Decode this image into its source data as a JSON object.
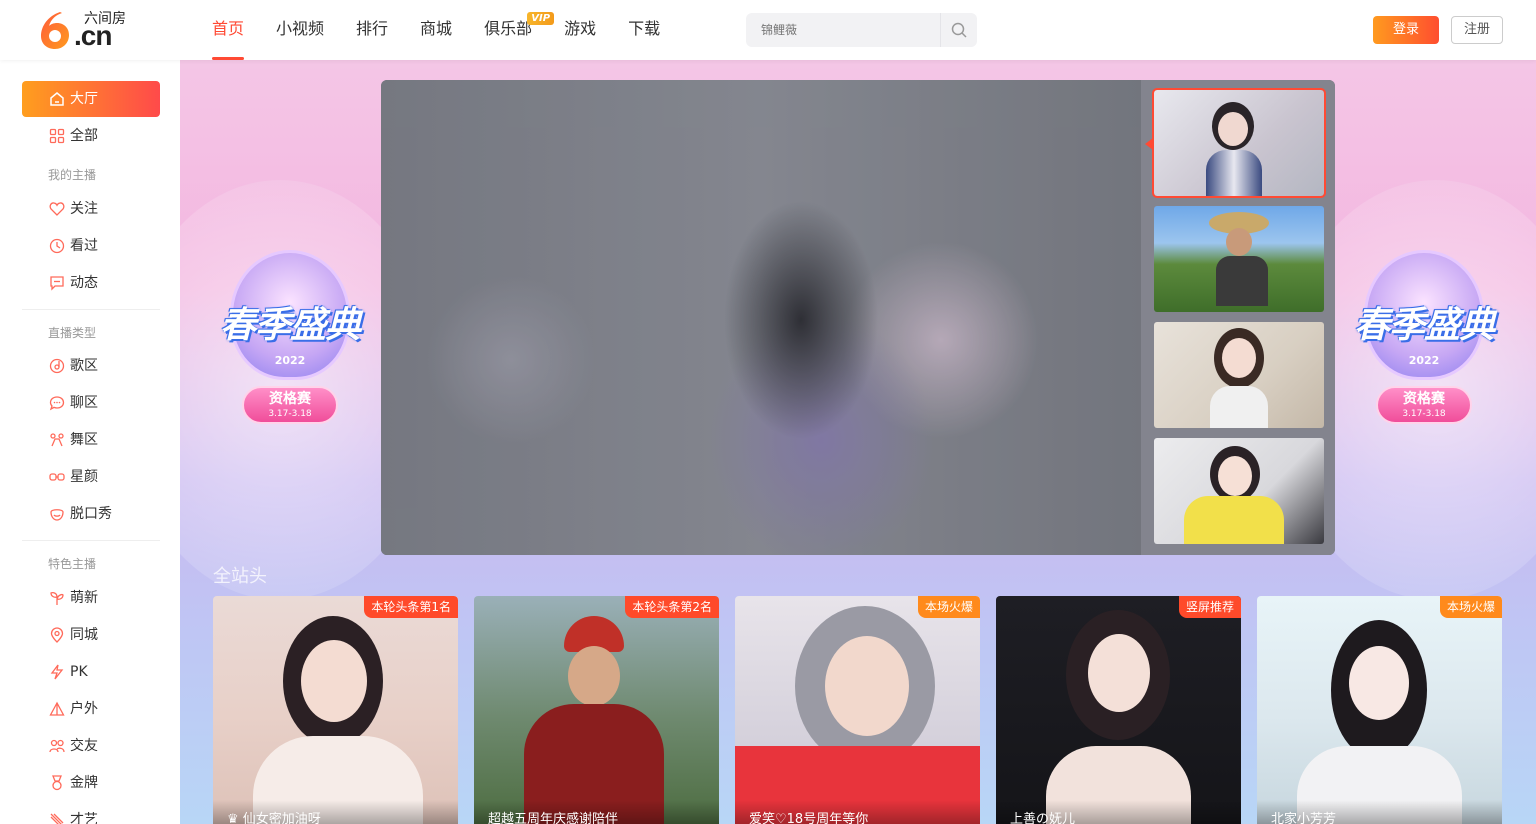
{
  "header": {
    "logo_text": "六间房",
    "logo_cn": ".cn",
    "nav": [
      {
        "label": "首页",
        "active": true
      },
      {
        "label": "小视频"
      },
      {
        "label": "排行"
      },
      {
        "label": "商城"
      },
      {
        "label": "俱乐部",
        "badge": "VIP"
      },
      {
        "label": "游戏"
      },
      {
        "label": "下载"
      }
    ],
    "search": {
      "placeholder": "锦鲤薇"
    },
    "login_label": "登录",
    "register_label": "注册"
  },
  "sidebar": {
    "items_top": [
      {
        "label": "大厅",
        "icon": "home-icon",
        "active": true
      },
      {
        "label": "全部",
        "icon": "grid-icon"
      }
    ],
    "groups": [
      {
        "title": "我的主播",
        "items": [
          {
            "label": "关注",
            "icon": "heart-icon"
          },
          {
            "label": "看过",
            "icon": "clock-icon"
          },
          {
            "label": "动态",
            "icon": "message-icon"
          }
        ]
      },
      {
        "title": "直播类型",
        "items": [
          {
            "label": "歌区",
            "icon": "music-icon"
          },
          {
            "label": "聊区",
            "icon": "chat-icon"
          },
          {
            "label": "舞区",
            "icon": "dance-icon"
          },
          {
            "label": "星颜",
            "icon": "glasses-icon"
          },
          {
            "label": "脱口秀",
            "icon": "smile-icon"
          }
        ]
      },
      {
        "title": "特色主播",
        "items": [
          {
            "label": "萌新",
            "icon": "sprout-icon"
          },
          {
            "label": "同城",
            "icon": "location-icon"
          },
          {
            "label": "PK",
            "icon": "lightning-icon"
          },
          {
            "label": "户外",
            "icon": "tent-icon"
          },
          {
            "label": "交友",
            "icon": "users-icon"
          },
          {
            "label": "金牌",
            "icon": "medal-icon"
          },
          {
            "label": "才艺",
            "icon": "palette-icon"
          }
        ]
      }
    ]
  },
  "banner": {
    "event_title": "春季盛典",
    "event_year": "2022",
    "event_stage": "资格赛",
    "event_dates": "3.17-3.18"
  },
  "section": {
    "title": "全站头"
  },
  "cards": [
    {
      "tag": "本轮头条第1名",
      "tag_color": "#ff4a2a",
      "name": "♛ 仙女密加油呀"
    },
    {
      "tag": "本轮头条第2名",
      "tag_color": "#ff4a2a",
      "name": "超越五周年庆感谢陪伴"
    },
    {
      "tag": "本场火爆",
      "tag_color": "#ff8a1c",
      "name": "爱笑♡18号周年等你"
    },
    {
      "tag": "竖屏推荐",
      "tag_color": "#ff4a2a",
      "name": "上善の妩儿"
    },
    {
      "tag": "本场火爆",
      "tag_color": "#ff8a1c",
      "name": "北家小芳芳"
    }
  ],
  "colors": {
    "accent": "#ff4a34",
    "gradient_start": "#ff9e1e",
    "gradient_end": "#ff4a4a"
  }
}
